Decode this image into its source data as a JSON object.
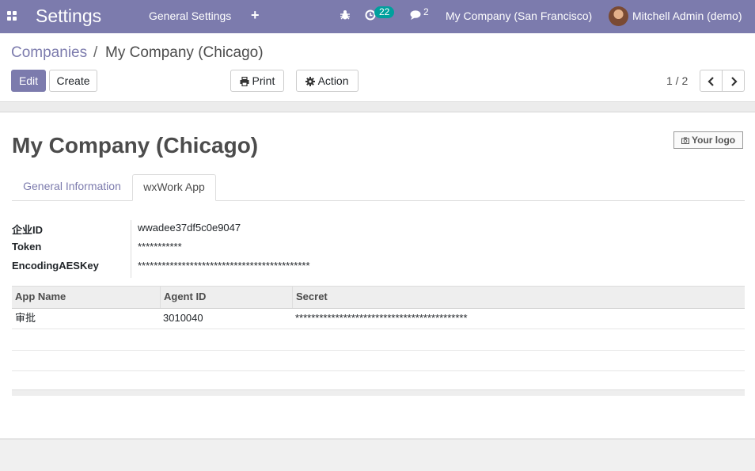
{
  "navbar": {
    "app_title": "Settings",
    "menu_general": "General Settings",
    "add_symbol": "+",
    "activity_count": "22",
    "message_count": "2",
    "company_switcher": "My Company (San Francisco)",
    "user": "Mitchell Admin (demo)"
  },
  "breadcrumb": {
    "parent": "Companies",
    "separator": "/",
    "current": "My Company (Chicago)"
  },
  "toolbar": {
    "edit": "Edit",
    "create": "Create",
    "print": "Print",
    "action": "Action",
    "pager": "1 / 2"
  },
  "form": {
    "title": "My Company (Chicago)",
    "logo_label": "Your logo",
    "tabs": [
      "General Information",
      "wxWork App"
    ],
    "fields": [
      {
        "label": "企业ID",
        "value": "wwadee37df5c0e9047"
      },
      {
        "label": "Token",
        "value": "***********"
      },
      {
        "label": "EncodingAESKey",
        "value": "*******************************************"
      }
    ]
  },
  "table": {
    "columns": [
      "App Name",
      "Agent ID",
      "Secret"
    ],
    "rows": [
      [
        "审批",
        "3010040",
        "*******************************************"
      ]
    ]
  },
  "colors": {
    "brand": "#7c7bad",
    "badge": "#00a09d"
  },
  "icons": [
    "apps-grid-icon",
    "bug-icon",
    "clock-icon",
    "chat-icon",
    "print-icon",
    "gear-icon",
    "chevron-left-icon",
    "chevron-right-icon",
    "camera-icon"
  ]
}
